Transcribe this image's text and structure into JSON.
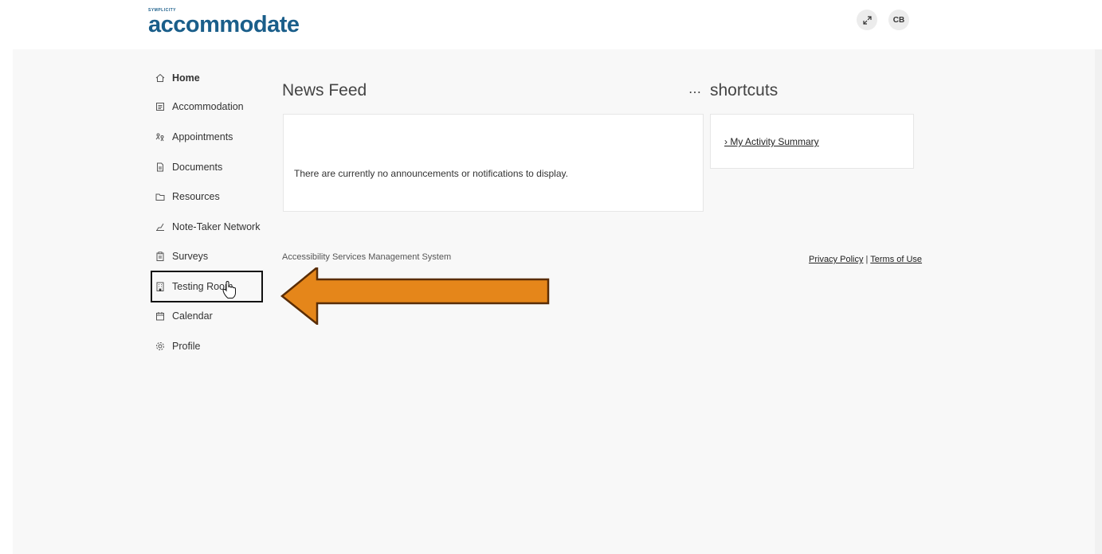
{
  "header": {
    "logo_small": "SYMPLICITY",
    "logo_main": "accommodate",
    "expand_icon": "expand-icon",
    "avatar_initials": "CB"
  },
  "sidebar": {
    "items": [
      {
        "label": "Home",
        "icon": "home-icon",
        "active": true
      },
      {
        "label": "Accommodation",
        "icon": "document-list-icon"
      },
      {
        "label": "Appointments",
        "icon": "people-icon"
      },
      {
        "label": "Documents",
        "icon": "file-icon"
      },
      {
        "label": "Resources",
        "icon": "folder-icon"
      },
      {
        "label": "Note-Taker Network",
        "icon": "hand-write-icon"
      },
      {
        "label": "Surveys",
        "icon": "clipboard-icon"
      },
      {
        "label": "Testing Room",
        "icon": "building-icon"
      },
      {
        "label": "Calendar",
        "icon": "calendar-icon"
      },
      {
        "label": "Profile",
        "icon": "gear-icon"
      }
    ]
  },
  "main": {
    "newsfeed_title": "News Feed",
    "newsfeed_message": "There are currently no announcements or notifications to display.",
    "more_label": "⋯",
    "shortcuts_title": "shortcuts",
    "shortcut_link": "› My Activity Summary"
  },
  "footer": {
    "system_name": "Accessibility Services Management System",
    "privacy": "Privacy Policy",
    "separator": " | ",
    "terms": "Terms of Use"
  },
  "colors": {
    "brand": "#1a5e8a",
    "arrow_fill": "#e5861a",
    "arrow_stroke": "#5a2d06"
  }
}
